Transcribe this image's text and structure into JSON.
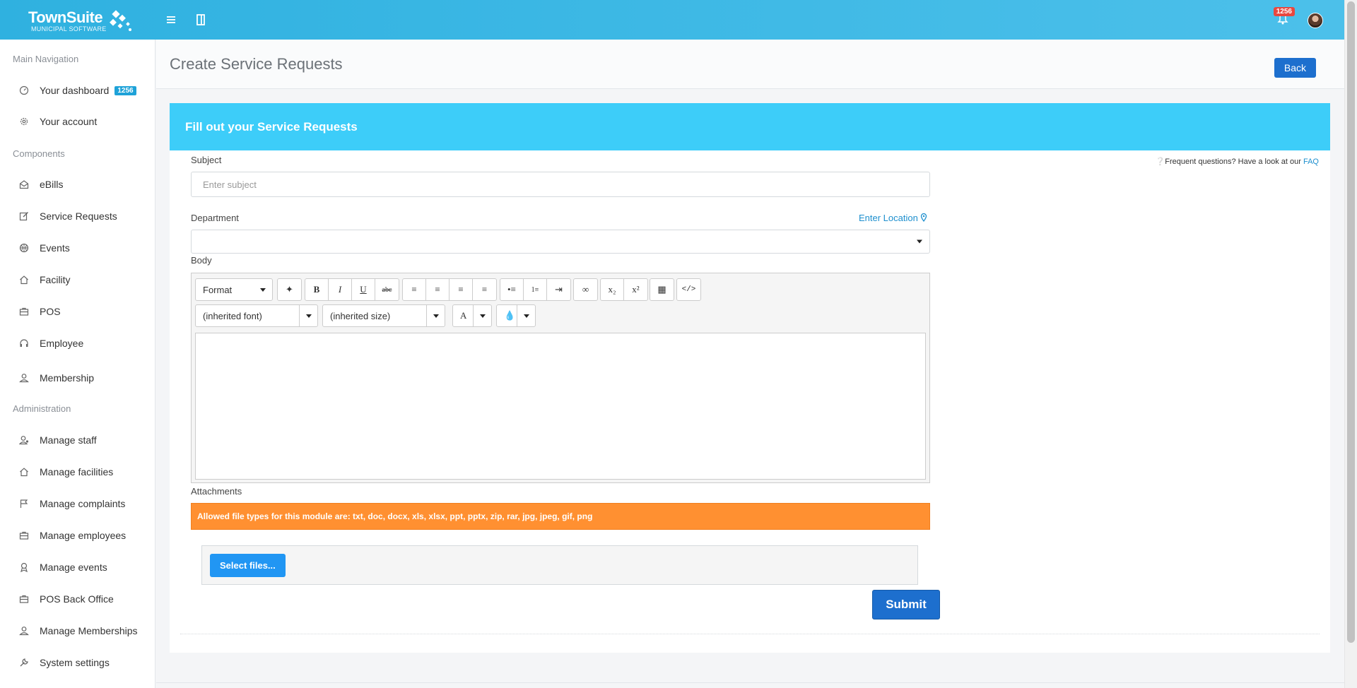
{
  "app": {
    "logo_name": "TownSuite",
    "logo_tag": "MUNICIPAL SOFTWARE",
    "notification_count": "1256",
    "accent": "#2fb1e0"
  },
  "sidebar": {
    "sections": [
      {
        "title": "Main Navigation"
      },
      {
        "title": "Components"
      },
      {
        "title": "Administration"
      }
    ],
    "items": [
      {
        "label": "Your dashboard",
        "icon": "dashboard-icon",
        "badge": "1256"
      },
      {
        "label": "Your account",
        "icon": "gear-icon"
      },
      {
        "label": "eBills",
        "icon": "envelope-open-icon"
      },
      {
        "label": "Service Requests",
        "icon": "edit-icon"
      },
      {
        "label": "Events",
        "icon": "basketball-icon"
      },
      {
        "label": "Facility",
        "icon": "home-icon"
      },
      {
        "label": "POS",
        "icon": "briefcase-icon"
      },
      {
        "label": "Employee",
        "icon": "headset-icon"
      },
      {
        "label": "Membership",
        "icon": "user-icon"
      },
      {
        "label": "Manage staff",
        "icon": "user-badge-icon"
      },
      {
        "label": "Manage facilities",
        "icon": "home-icon"
      },
      {
        "label": "Manage complaints",
        "icon": "flag-icon"
      },
      {
        "label": "Manage employees",
        "icon": "briefcase-icon"
      },
      {
        "label": "Manage events",
        "icon": "award-icon"
      },
      {
        "label": "POS Back Office",
        "icon": "briefcase-icon"
      },
      {
        "label": "Manage Memberships",
        "icon": "user-icon"
      },
      {
        "label": "System settings",
        "icon": "wrench-icon"
      }
    ]
  },
  "header": {
    "title": "Create Service Requests",
    "back_label": "Back"
  },
  "form": {
    "panel_title": "Fill out your Service Requests",
    "faq_prefix": "Frequent questions? Have a look at our ",
    "faq_link": "FAQ",
    "subject_label": "Subject",
    "subject_placeholder": "Enter subject",
    "department_label": "Department",
    "department_value": "",
    "enter_location": "Enter Location",
    "body_label": "Body",
    "attachments_label": "Attachments",
    "allowed_types": "Allowed file types for this module are: txt, doc, docx, xls, xlsx, ppt, pptx, zip, rar, jpg, jpeg, gif, png",
    "select_files": "Select files...",
    "submit": "Submit",
    "alert_color": "#ff9031"
  },
  "editor": {
    "format_label": "Format",
    "font_label": "(inherited font)",
    "size_label": "(inherited size)",
    "text_color_glyph": "A",
    "toolbar": [
      "clean-format-icon",
      "bold-icon",
      "italic-icon",
      "underline-icon",
      "strikethrough-icon",
      "align-left-icon",
      "align-center-icon",
      "align-right-icon",
      "align-justify-icon",
      "bullet-list-icon",
      "numbered-list-icon",
      "indent-icon",
      "link-icon",
      "subscript-icon",
      "superscript-icon",
      "table-icon",
      "code-view-icon"
    ]
  }
}
